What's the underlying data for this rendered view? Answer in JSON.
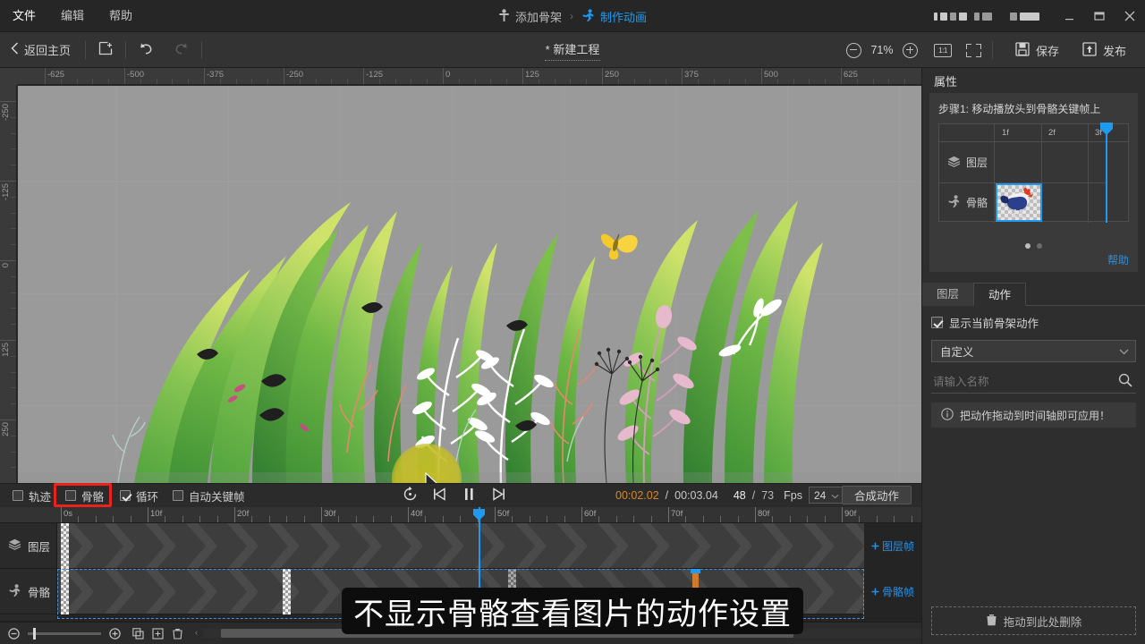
{
  "menu": {
    "items": [
      {
        "label": "文件"
      },
      {
        "label": "编辑"
      },
      {
        "label": "帮助"
      }
    ]
  },
  "breadcrumb": {
    "step1": "添加骨架",
    "separator": "›",
    "step2": "制作动画",
    "active_color": "#1e9bf0"
  },
  "window": {
    "minimize": "—",
    "maximize": "▭",
    "close": "✕"
  },
  "toolbar": {
    "back_label": "返回主页",
    "back_icon": "chevron-left-icon",
    "new_icon": "new-canvas-icon",
    "undo_icon": "undo-icon",
    "redo_icon": "redo-icon",
    "project_title": "* 新建工程",
    "zoom_out_icon": "zoom-out-icon",
    "zoom_value": "71%",
    "zoom_in_icon": "zoom-in-icon",
    "ratio_label": "1:1",
    "fit_icon": "fit-screen-icon",
    "save_label": "保存",
    "save_icon": "save-icon",
    "publish_label": "发布",
    "publish_icon": "publish-icon"
  },
  "stage": {
    "ruler_h": [
      "-625",
      "-500",
      "-375",
      "-250",
      "-125",
      "0",
      "125",
      "250",
      "375",
      "500",
      "625"
    ],
    "ruler_v": [
      "-250",
      "-125",
      "0",
      "125",
      "250"
    ],
    "canvas_bg": "#9a9a9a",
    "selection_color": "#c4be28"
  },
  "properties": {
    "title": "属性",
    "guide_step": "步骤1: 移动播放头到骨骼关键帧上",
    "mini_timeline": {
      "frames": [
        "1f",
        "2f",
        "3f"
      ],
      "rows": [
        {
          "label": "图层",
          "icon": "layers-icon"
        },
        {
          "label": "骨骼",
          "icon": "skeleton-icon"
        }
      ]
    },
    "help_label": "帮助",
    "tabs": [
      {
        "label": "图层",
        "active": false
      },
      {
        "label": "动作",
        "active": true
      }
    ],
    "show_current_action": {
      "label": "显示当前骨架动作",
      "checked": true
    },
    "category_select": {
      "value": "自定义",
      "chevron": "chevron-down-icon"
    },
    "search": {
      "placeholder": "请输入名称",
      "icon": "search-icon"
    },
    "notice": {
      "icon": "info-icon",
      "text": "把动作拖动到时间轴即可应用！"
    },
    "trash_zone": {
      "icon": "trash-icon",
      "text": "拖动到此处删除"
    }
  },
  "timeline_bar": {
    "checkboxes": [
      {
        "label": "轨迹",
        "checked": false,
        "highlight": false
      },
      {
        "label": "骨骼",
        "checked": false,
        "highlight": true
      },
      {
        "label": "循环",
        "checked": true,
        "highlight": false
      },
      {
        "label": "自动关键帧",
        "checked": false,
        "highlight": false
      }
    ],
    "highlight_color": "#e8221e",
    "controls": [
      "replay-icon",
      "step-back-icon",
      "pause-icon",
      "step-forward-icon"
    ],
    "time_current": "00:02.02",
    "time_sep": "/",
    "time_total": "00:03.04",
    "frame_current": "48",
    "frame_sep": "/",
    "frame_total": "73",
    "fps_label": "Fps",
    "fps_value": "24",
    "compose_label": "合成动作"
  },
  "timeline": {
    "ruler": [
      "0s",
      "10f",
      "20f",
      "30f",
      "40f",
      "50f",
      "60f",
      "70f",
      "80f",
      "90f"
    ],
    "rows": [
      {
        "label": "图层",
        "icon": "layers-icon",
        "add_label": "图层帧"
      },
      {
        "label": "骨骼",
        "icon": "skeleton-icon",
        "add_label": "骨骼帧"
      }
    ],
    "add_icon": "plus-icon",
    "playhead_frame": "48",
    "footer_icons": [
      "zoom-out-icon",
      "zoom-in-icon",
      "copy-icon",
      "duplicate-icon",
      "delete-icon"
    ]
  },
  "caption": {
    "text": "不显示骨骼查看图片的动作设置"
  }
}
